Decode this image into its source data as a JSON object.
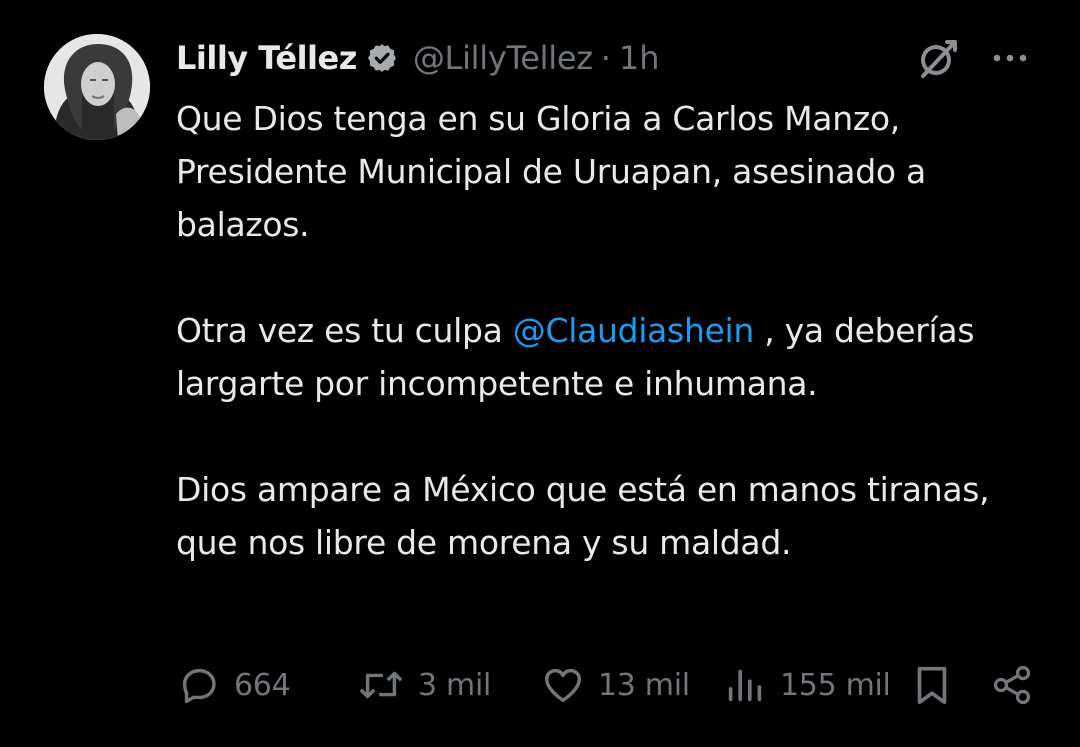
{
  "author": {
    "display_name": "Lilly Téllez",
    "handle": "@LillyTellez",
    "separator": "·",
    "time": "1h",
    "verified": true
  },
  "tweet": {
    "paragraphs": [
      {
        "text": "Que Dios tenga en su Gloria a Carlos Manzo, Presidente Municipal de Uruapan, asesinado a balazos."
      },
      {
        "before": "Otra vez es tu culpa ",
        "mention": "@Claudiashein",
        "after": " , ya deberías largarte por incompetente e inhumana."
      },
      {
        "text": "Dios ampare a México que está en manos tiranas, que nos libre de morena y su maldad."
      }
    ]
  },
  "actions": {
    "replies": "664",
    "reposts": "3 mil",
    "likes": "13 mil",
    "views": "155 mil"
  },
  "icons": {
    "verified": "verified-badge-icon",
    "grok": "grok-icon",
    "more": "more-icon",
    "reply": "reply-icon",
    "repost": "repost-icon",
    "like": "heart-icon",
    "views": "views-icon",
    "bookmark": "bookmark-icon",
    "share": "share-icon"
  },
  "colors": {
    "background": "#000000",
    "text": "#e7e9ea",
    "muted": "#71767b",
    "mention": "#1d9bf0"
  }
}
